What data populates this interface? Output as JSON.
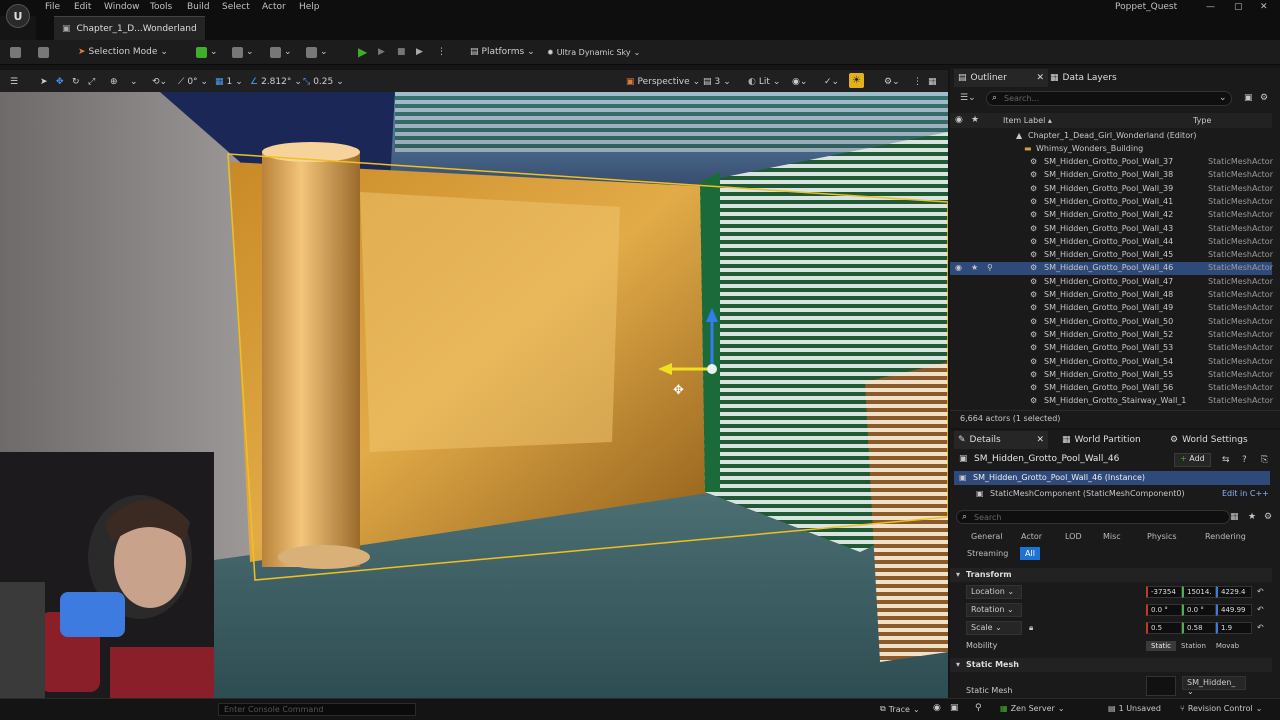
{
  "menu": {
    "items": [
      "File",
      "Edit",
      "Window",
      "Tools",
      "Build",
      "Select",
      "Actor",
      "Help"
    ],
    "project": "Poppet_Quest"
  },
  "window": {
    "level_tab": "Chapter_1_D...Wonderland"
  },
  "toolbar": {
    "mode": "Selection Mode",
    "platforms": "Platforms",
    "sky": "Ultra Dynamic Sky"
  },
  "viewport_toolbar": {
    "rotate_snap": "0°",
    "grid_snap": "1",
    "scale_value": "2.812°",
    "scale_snap": "0.25",
    "view": "Perspective",
    "speed": "3",
    "lit": "Lit"
  },
  "outliner": {
    "tab": "Outliner",
    "tab2": "Data Layers",
    "search_placeholder": "Search...",
    "col_label": "Item Label",
    "col_type": "Type",
    "level": "Chapter_1_Dead_Girl_Wonderland (Editor)",
    "folder": "Whimsy_Wonders_Building",
    "rows": [
      {
        "label": "SM_Hidden_Grotto_Pool_Wall_37",
        "type": "StaticMeshActor"
      },
      {
        "label": "SM_Hidden_Grotto_Pool_Wall_38",
        "type": "StaticMeshActor"
      },
      {
        "label": "SM_Hidden_Grotto_Pool_Wall_39",
        "type": "StaticMeshActor"
      },
      {
        "label": "SM_Hidden_Grotto_Pool_Wall_41",
        "type": "StaticMeshActor"
      },
      {
        "label": "SM_Hidden_Grotto_Pool_Wall_42",
        "type": "StaticMeshActor"
      },
      {
        "label": "SM_Hidden_Grotto_Pool_Wall_43",
        "type": "StaticMeshActor"
      },
      {
        "label": "SM_Hidden_Grotto_Pool_Wall_44",
        "type": "StaticMeshActor"
      },
      {
        "label": "SM_Hidden_Grotto_Pool_Wall_45",
        "type": "StaticMeshActor"
      },
      {
        "label": "SM_Hidden_Grotto_Pool_Wall_46",
        "type": "StaticMeshActor"
      },
      {
        "label": "SM_Hidden_Grotto_Pool_Wall_47",
        "type": "StaticMeshActor"
      },
      {
        "label": "SM_Hidden_Grotto_Pool_Wall_48",
        "type": "StaticMeshActor"
      },
      {
        "label": "SM_Hidden_Grotto_Pool_Wall_49",
        "type": "StaticMeshActor"
      },
      {
        "label": "SM_Hidden_Grotto_Pool_Wall_50",
        "type": "StaticMeshActor"
      },
      {
        "label": "SM_Hidden_Grotto_Pool_Wall_52",
        "type": "StaticMeshActor"
      },
      {
        "label": "SM_Hidden_Grotto_Pool_Wall_53",
        "type": "StaticMeshActor"
      },
      {
        "label": "SM_Hidden_Grotto_Pool_Wall_54",
        "type": "StaticMeshActor"
      },
      {
        "label": "SM_Hidden_Grotto_Pool_Wall_55",
        "type": "StaticMeshActor"
      },
      {
        "label": "SM_Hidden_Grotto_Pool_Wall_56",
        "type": "StaticMeshActor"
      },
      {
        "label": "SM_Hidden_Grotto_Stairway_Wall_1",
        "type": "StaticMeshActor"
      }
    ],
    "selected_index": 8,
    "footer": "6,664 actors (1 selected)"
  },
  "details": {
    "tab": "Details",
    "tab2": "World Partition",
    "tab3": "World Settings",
    "actor_name": "SM_Hidden_Grotto_Pool_Wall_46",
    "add": "Add",
    "instance": "SM_Hidden_Grotto_Pool_Wall_46 (Instance)",
    "component": "StaticMeshComponent (StaticMeshComponent0)",
    "edit_cpp": "Edit in C++",
    "search_placeholder": "Search",
    "filters": [
      "General",
      "Actor",
      "LOD",
      "Misc",
      "Physics",
      "Rendering",
      "Streaming",
      "All"
    ],
    "transform_header": "Transform",
    "location": {
      "label": "Location",
      "x": "-37354",
      "y": "15014.",
      "z": "4229.4"
    },
    "rotation": {
      "label": "Rotation",
      "x": "0.0 °",
      "y": "0.0 °",
      "z": "449.99"
    },
    "scale": {
      "label": "Scale",
      "x": "0.5",
      "y": "0.58",
      "z": "1.9"
    },
    "mobility": {
      "label": "Mobility",
      "options": [
        "Static",
        "Station",
        "Movab"
      ]
    },
    "static_mesh_header": "Static Mesh",
    "static_mesh_label": "Static Mesh",
    "static_mesh_value": "SM_Hidden_"
  },
  "status": {
    "console_placeholder": "Enter Console Command",
    "trace": "Trace",
    "zen": "Zen Server",
    "unsaved": "1 Unsaved",
    "revision": "Revision Control"
  },
  "colors": {
    "accent": "#2d4a7a",
    "play": "#3fae2a",
    "selection_outline": "#f0c020"
  }
}
